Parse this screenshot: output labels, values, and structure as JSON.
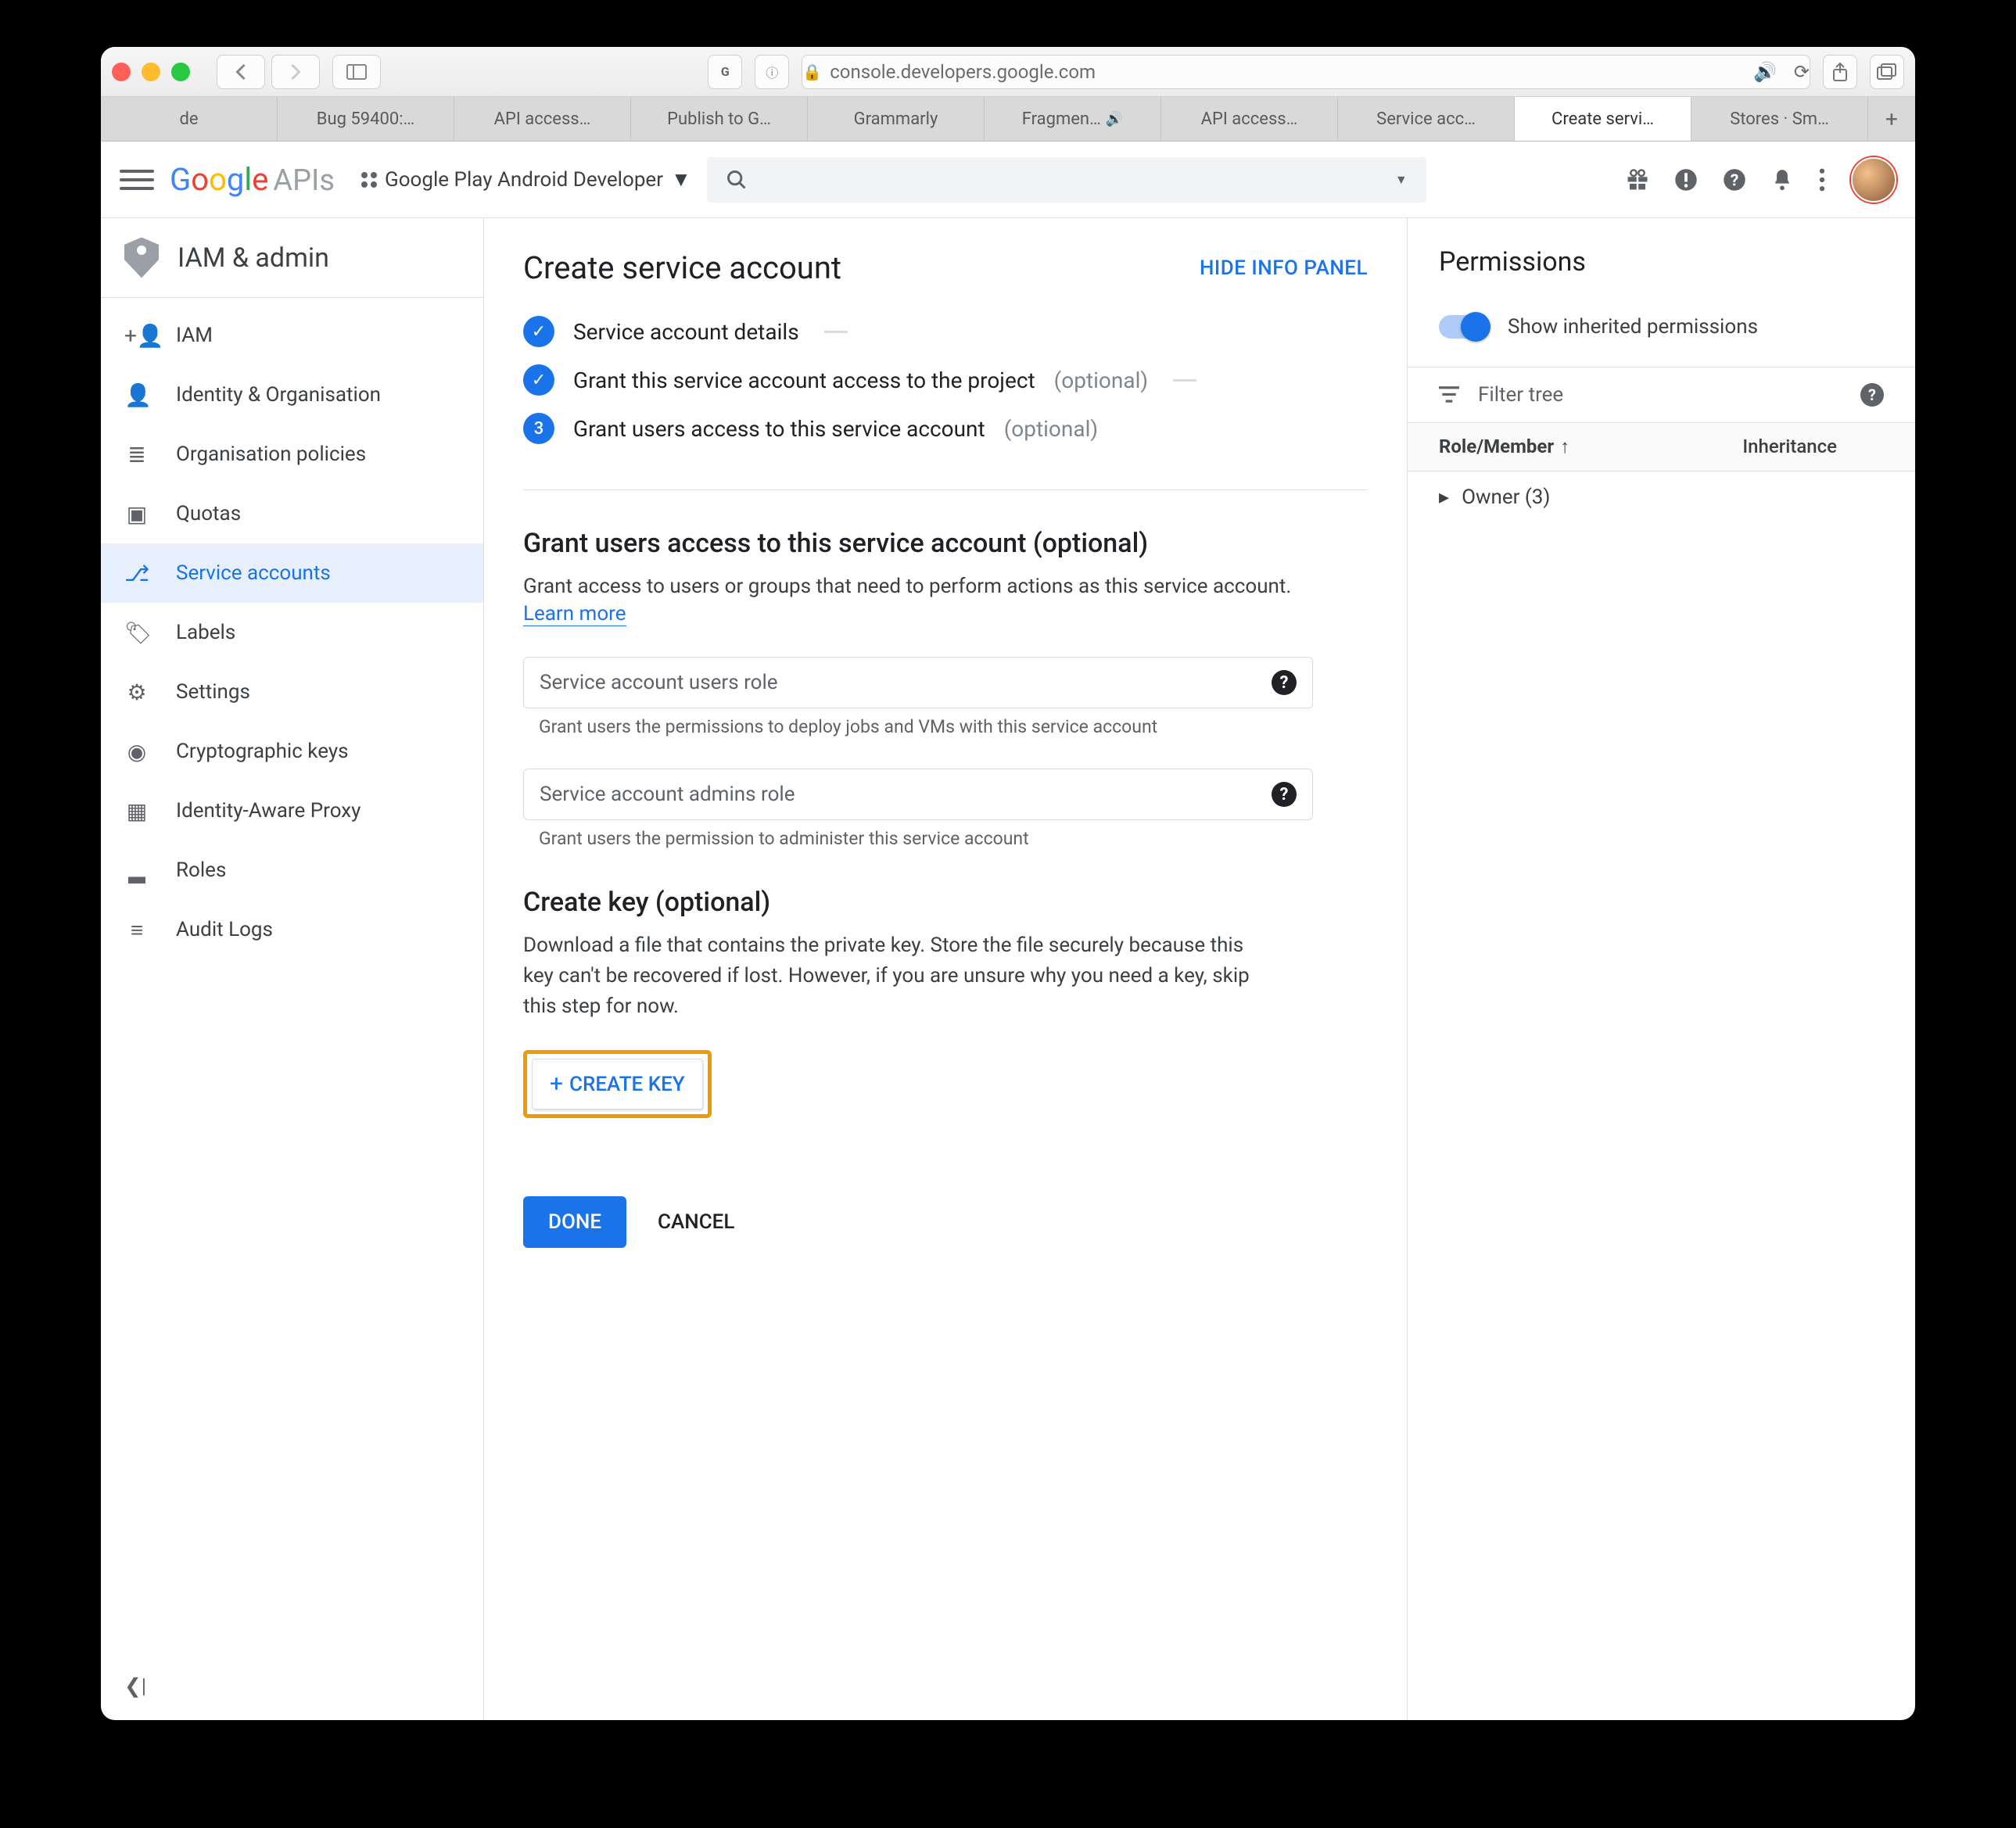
{
  "browser": {
    "url": "console.developers.google.com",
    "tabs": [
      "de",
      "Bug 59400:…",
      "API access…",
      "Publish to G…",
      "Grammarly",
      "Fragmen…",
      "API access…",
      "Service acc…",
      "Create servi…",
      "Stores · Sm…"
    ],
    "active_tab_index": 8,
    "audio_tab_index": 5
  },
  "header": {
    "product": "APIs",
    "project": "Google Play Android Developer"
  },
  "sidebar": {
    "title": "IAM & admin",
    "items": [
      {
        "label": "IAM",
        "icon": "+👤"
      },
      {
        "label": "Identity & Organisation",
        "icon": "👤"
      },
      {
        "label": "Organisation policies",
        "icon": "≣"
      },
      {
        "label": "Quotas",
        "icon": "▣"
      },
      {
        "label": "Service accounts",
        "icon": "⎇"
      },
      {
        "label": "Labels",
        "icon": "🏷"
      },
      {
        "label": "Settings",
        "icon": "⚙"
      },
      {
        "label": "Cryptographic keys",
        "icon": "◉"
      },
      {
        "label": "Identity-Aware Proxy",
        "icon": "▦"
      },
      {
        "label": "Roles",
        "icon": "▂"
      },
      {
        "label": "Audit Logs",
        "icon": "≡"
      }
    ],
    "active_index": 4
  },
  "page": {
    "title": "Create service account",
    "hide_panel": "HIDE INFO PANEL",
    "steps": [
      {
        "label": "Service account details",
        "done": true
      },
      {
        "label": "Grant this service account access to the project",
        "optional": "(optional)",
        "done": true
      },
      {
        "num": "3",
        "label": "Grant users access to this service account",
        "optional": "(optional)"
      }
    ],
    "grant_section": {
      "heading": "Grant users access to this service account (optional)",
      "desc": "Grant access to users or groups that need to perform actions as this service account.",
      "learn": "Learn more",
      "field1_placeholder": "Service account users role",
      "field1_hint": "Grant users the permissions to deploy jobs and VMs with this service account",
      "field2_placeholder": "Service account admins role",
      "field2_hint": "Grant users the permission to administer this service account"
    },
    "key_section": {
      "heading": "Create key (optional)",
      "desc": "Download a file that contains the private key. Store the file securely because this key can't be recovered if lost. However, if you are unsure why you need a key, skip this step for now.",
      "button": "CREATE KEY"
    },
    "done": "DONE",
    "cancel": "CANCEL"
  },
  "right": {
    "heading": "Permissions",
    "toggle_label": "Show inherited permissions",
    "filter_placeholder": "Filter tree",
    "col_role": "Role/Member",
    "col_inh": "Inheritance",
    "row_owner": "Owner (3)"
  }
}
